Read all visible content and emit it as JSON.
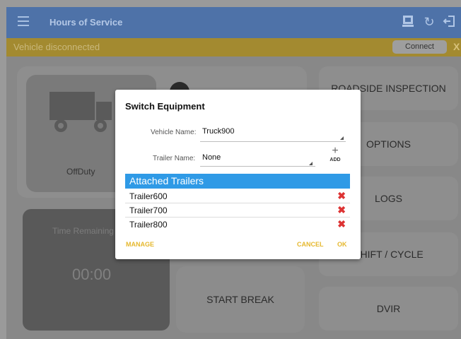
{
  "app_bar": {
    "title": "Hours of Service",
    "icons": [
      "menu-icon",
      "switch-equipment-icon",
      "refresh-icon",
      "logout-icon"
    ]
  },
  "banner": {
    "message": "Vehicle disconnected",
    "connect_label": "Connect",
    "close_label": "X"
  },
  "dashboard": {
    "status_label": "OffDuty",
    "time_remaining_label": "Time Remaining",
    "timer_value": "00:00",
    "start_break_label": "START BREAK",
    "right_buttons": [
      "ROADSIDE INSPECTION",
      "OPTIONS",
      "LOGS",
      "SHIFT / CYCLE",
      "DVIR"
    ]
  },
  "dialog": {
    "title": "Switch Equipment",
    "vehicle_label": "Vehicle Name:",
    "vehicle_value": "Truck900",
    "trailer_label": "Trailer Name:",
    "trailer_value": "None",
    "add_label": "ADD",
    "attached_header": "Attached Trailers",
    "trailers": [
      "Trailer600",
      "Trailer700",
      "Trailer800"
    ],
    "manage_label": "MANAGE",
    "cancel_label": "CANCEL",
    "ok_label": "OK"
  },
  "colors": {
    "app_bar": "#4e72a8",
    "banner": "#a38a30",
    "accent_blue": "#2f9ae6",
    "action_yellow": "#e6b82e",
    "delete_red": "#dd3333"
  }
}
